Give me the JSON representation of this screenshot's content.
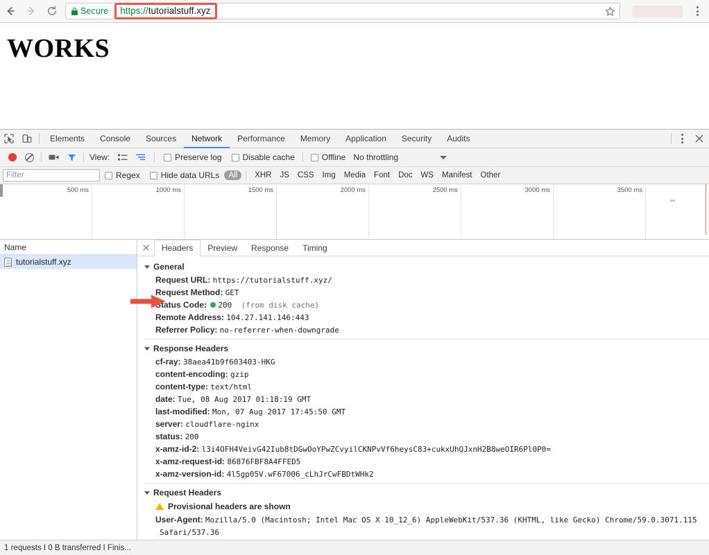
{
  "browser": {
    "back_icon": "back-arrow-icon",
    "forward_icon": "forward-arrow-icon",
    "reload_icon": "reload-icon",
    "security_label": "Secure",
    "url_scheme": "https://",
    "url_rest": "tutorialstuff.xyz",
    "url_full": "https://tutorialstuff.xyz",
    "bookmark_icon": "star-icon",
    "menu_icon": "kebab-menu-icon",
    "highlight_color": "#ef5350",
    "secure_color": "#0f8a3c"
  },
  "page": {
    "heading": "WORKS"
  },
  "devtools": {
    "inspect_icon": "inspect-element-icon",
    "device_icon": "device-toolbar-icon",
    "tabs": [
      {
        "label": "Elements",
        "active": false
      },
      {
        "label": "Console",
        "active": false
      },
      {
        "label": "Sources",
        "active": false
      },
      {
        "label": "Network",
        "active": true
      },
      {
        "label": "Performance",
        "active": false
      },
      {
        "label": "Memory",
        "active": false
      },
      {
        "label": "Application",
        "active": false
      },
      {
        "label": "Security",
        "active": false
      },
      {
        "label": "Audits",
        "active": false
      }
    ],
    "more_icon": "kebab-menu-icon",
    "close_icon": "close-icon",
    "toolbar": {
      "record_icon": "record-icon",
      "clear_icon": "clear-icon",
      "capture_screenshots_icon": "camera-icon",
      "filter_icon": "funnel-icon",
      "view_label": "View:",
      "view_list_icon": "list-view-icon",
      "view_waterfall_icon": "waterfall-view-icon",
      "preserve_log_label": "Preserve log",
      "preserve_log_checked": false,
      "disable_cache_label": "Disable cache",
      "disable_cache_checked": false,
      "offline_label": "Offline",
      "offline_checked": false,
      "throttling_value": "No throttling",
      "throttling_caret_icon": "chevron-down-icon"
    },
    "filterbar": {
      "filter_placeholder": "Filter",
      "filter_value": "",
      "regex_label": "Regex",
      "regex_checked": false,
      "hide_data_urls_label": "Hide data URLs",
      "hide_data_urls_checked": false,
      "types": [
        "All",
        "XHR",
        "JS",
        "CSS",
        "Img",
        "Media",
        "Font",
        "Doc",
        "WS",
        "Manifest",
        "Other"
      ],
      "active_type": "All"
    },
    "overview": {
      "ticks": [
        "500 ms",
        "1000 ms",
        "1500 ms",
        "2000 ms",
        "2500 ms",
        "3000 ms",
        "3500 ms"
      ],
      "marker_color": "#e06c6c"
    },
    "requests": {
      "column_header": "Name",
      "rows": [
        {
          "name": "tutorialstuff.xyz",
          "icon": "document-icon",
          "selected": true
        }
      ]
    },
    "status_bar": "1 requests I 0 B transferred I Finis...",
    "detail": {
      "close_icon": "close-icon",
      "tabs": [
        {
          "label": "Headers",
          "active": true
        },
        {
          "label": "Preview",
          "active": false
        },
        {
          "label": "Response",
          "active": false
        },
        {
          "label": "Timing",
          "active": false
        }
      ],
      "sections": [
        {
          "title": "General",
          "rows": [
            {
              "key": "Request URL:",
              "value": "https://tutorialstuff.xyz/"
            },
            {
              "key": "Request Method:",
              "value": "GET"
            },
            {
              "key": "Status Code:",
              "value": "200",
              "dot": true,
              "note": "(from disk cache)"
            },
            {
              "key": "Remote Address:",
              "value": "104.27.141.146:443"
            },
            {
              "key": "Referrer Policy:",
              "value": "no-referrer-when-downgrade"
            }
          ]
        },
        {
          "title": "Response Headers",
          "rows": [
            {
              "key": "cf-ray:",
              "value": "38aea41b9f603403-HKG"
            },
            {
              "key": "content-encoding:",
              "value": "gzip"
            },
            {
              "key": "content-type:",
              "value": "text/html"
            },
            {
              "key": "date:",
              "value": "Tue, 08 Aug 2017 01:18:19 GMT"
            },
            {
              "key": "last-modified:",
              "value": "Mon, 07 Aug 2017 17:45:50 GMT"
            },
            {
              "key": "server:",
              "value": "cloudflare-nginx"
            },
            {
              "key": "status:",
              "value": "200"
            },
            {
              "key": "x-amz-id-2:",
              "value": "l3i4OFH4VeivG42Iub8tDGwOoYPwZCvyilCKNPvVf6heysC83+cukxUhQJxnH2B8weOIR6Pl0P0="
            },
            {
              "key": "x-amz-request-id:",
              "value": "86876FBF8A4FFED5"
            },
            {
              "key": "x-amz-version-id:",
              "value": "4l5gp05V.wF67006_cLhJrCwFBDtWHk2"
            }
          ]
        }
      ],
      "request_headers": {
        "title": "Request Headers",
        "warning_icon": "warning-icon",
        "warning_text": "Provisional headers are shown",
        "ua_key": "User-Agent:",
        "ua_value": "Mozilla/5.0 (Macintosh; Intel Mac OS X 10_12_6) AppleWebKit/537.36 (KHTML, like Gecko) Chrome/59.0.3071.115",
        "ua_value_cont": "Safari/537.36"
      }
    }
  },
  "annotation": {
    "arrow_icon": "red-arrow-icon",
    "arrow_color": "#e8513a"
  }
}
